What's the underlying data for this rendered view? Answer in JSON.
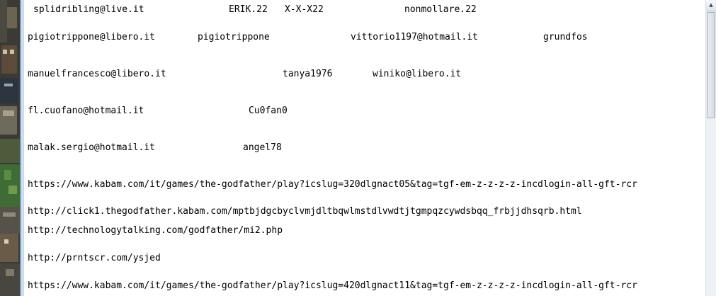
{
  "editor": {
    "lines": [
      {
        "segments": [
          "splidribling@live.it",
          "ERIK.22",
          "X-X-X22",
          "nonmollare.22"
        ]
      },
      {
        "segments": [
          "pigiotrippone@libero.it",
          "pigiotrippone",
          "vittorio1197@hotmail.it",
          "grundfos"
        ]
      },
      {
        "segments": [
          "manuelfrancesco@libero.it",
          "tanya1976",
          "winiko@libero.it"
        ]
      },
      {
        "segments": [
          "fl.cuofano@hotmail.it",
          "Cu0fan0"
        ]
      },
      {
        "segments": [
          "malak.sergio@hotmail.it",
          "angel78"
        ]
      },
      {
        "segments": [
          "https://www.kabam.com/it/games/the-godfather/play?icslug=320dlgnact05&tag=tgf-em-z-z-z-z-incdlogin-all-gft-rcr"
        ]
      },
      {
        "segments": [
          "http://click1.thegodfather.kabam.com/mptbjdgcbyclvmjdltbqwlmstdlvwdtjtgmpqzcywdsbqq_frbjjdhsqrb.html"
        ]
      },
      {
        "segments": [
          "http://technologytalking.com/godfather/mi2.php"
        ]
      },
      {
        "segments": [
          "http://prntscr.com/ysjed"
        ]
      },
      {
        "segments": [
          "https://www.kabam.com/it/games/the-godfather/play?icslug=420dlgnact11&tag=tgf-em-z-z-z-z-incdlogin-all-gft-rcr"
        ]
      }
    ]
  },
  "scrollbar": {
    "up_arrow_icon": "scroll-up-arrow-icon",
    "position": 0
  },
  "colors": {
    "text": "#000000",
    "background": "#ffffff",
    "window_frame": "#c4d7ea"
  }
}
